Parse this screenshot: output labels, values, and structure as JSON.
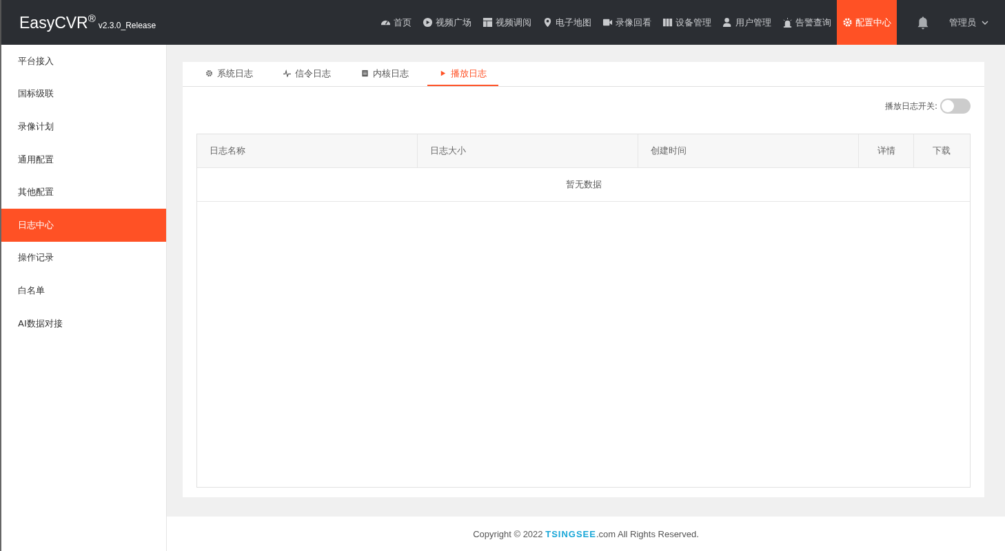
{
  "header": {
    "logo": "EasyCVR",
    "logo_mark": "®",
    "version": "v2.3.0_Release",
    "nav": [
      {
        "label": "首页",
        "selected": false
      },
      {
        "label": "视频广场",
        "selected": false
      },
      {
        "label": "视频调阅",
        "selected": false
      },
      {
        "label": "电子地图",
        "selected": false
      },
      {
        "label": "录像回看",
        "selected": false
      },
      {
        "label": "设备管理",
        "selected": false
      },
      {
        "label": "用户管理",
        "selected": false
      },
      {
        "label": "告警查询",
        "selected": false
      },
      {
        "label": "配置中心",
        "selected": true
      }
    ],
    "user": "管理员"
  },
  "sidebar": {
    "items": [
      {
        "label": "平台接入",
        "selected": false
      },
      {
        "label": "国标级联",
        "selected": false
      },
      {
        "label": "录像计划",
        "selected": false
      },
      {
        "label": "通用配置",
        "selected": false
      },
      {
        "label": "其他配置",
        "selected": false
      },
      {
        "label": "日志中心",
        "selected": true
      },
      {
        "label": "操作记录",
        "selected": false
      },
      {
        "label": "白名单",
        "selected": false
      },
      {
        "label": "AI数据对接",
        "selected": false
      }
    ]
  },
  "tabs": [
    {
      "label": "系统日志",
      "selected": false
    },
    {
      "label": "信令日志",
      "selected": false
    },
    {
      "label": "内核日志",
      "selected": false
    },
    {
      "label": "播放日志",
      "selected": true
    }
  ],
  "switch": {
    "label": "播放日志开关:",
    "on": false
  },
  "table": {
    "columns": [
      "日志名称",
      "日志大小",
      "创建时间",
      "详情",
      "下载"
    ],
    "empty_text": "暂无数据"
  },
  "footer": {
    "prefix": "Copyright © 2022 ",
    "brand": "TSINGSEE",
    "suffix": ".com All Rights Reserved."
  }
}
